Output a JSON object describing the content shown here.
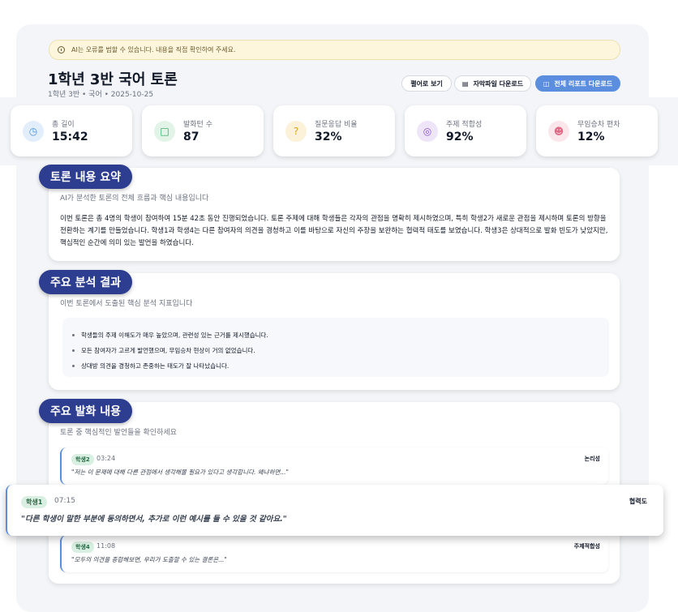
{
  "notice": {
    "text": "AI는 오류를 범할 수 있습니다. 내용을 직접 확인하여 주세요."
  },
  "header": {
    "title": "1학년 3반 국어 토론",
    "subtitle": "1학년 3반 • 국어 • 2025-10-25",
    "buttons": {
      "view": "펼어로 보기",
      "subtitle_download": "자막파일 다운로드",
      "report_download": "전체 리포트 다운로드"
    }
  },
  "stats": [
    {
      "label": "총 길이",
      "value": "15:42",
      "icon": "clock-icon",
      "color": "#4b8fe0"
    },
    {
      "label": "발화턴 수",
      "value": "87",
      "icon": "chat-icon",
      "color": "#2f9e5a"
    },
    {
      "label": "질문응답 비율",
      "value": "32%",
      "icon": "question-icon",
      "color": "#d9a21f"
    },
    {
      "label": "주제 적합성",
      "value": "92%",
      "icon": "target-icon",
      "color": "#8a54c7"
    },
    {
      "label": "무임승차 편차",
      "value": "12%",
      "icon": "users-icon",
      "color": "#e06b86"
    }
  ],
  "summary": {
    "heading": "토론 내용 요약",
    "subheading": "AI가 분석한 토론의 전체 흐름과 핵심 내용입니다",
    "body": "이번 토론은 총 4명의 학생이 참여하여 15분 42초 동안 진행되었습니다. 토론 주제에 대해 학생들은 각자의 관점을 명확히 제시하였으며, 특히 학생2가 새로운 관점을 제시하며 토론의 방향을 전환하는 계기를 만들었습니다. 학생1과 학생4는 다른 참여자의 의견을 경청하고 이를 바탕으로 자신의 주장을 보완하는 협력적 태도를 보였습니다. 학생3은 상대적으로 발화 빈도가 낮았지만, 핵심적인 순간에 의미 있는 발언을 하였습니다."
  },
  "analysis": {
    "heading": "주요 분석 결과",
    "subheading": "이번 토론에서 도출된 핵심 분석 지표입니다",
    "items": [
      "학생들의 주제 이해도가 매우 높았으며, 관련성 있는 근거를 제시했습니다.",
      "모든 참여자가 고르게 발언했으며, 무임승차 현상이 거의 없었습니다.",
      "상대방 의견을 경청하고 존중하는 태도가 잘 나타났습니다."
    ]
  },
  "utterances": {
    "heading": "주요 발화 내용",
    "subheading": "토론 중 핵심적인 발언들을 확인하세요",
    "items": [
      {
        "speaker": "학생2",
        "time": "03:24",
        "tag": "논리성",
        "text": "\"저는 이 문제에 대해 다른 관점에서 생각해볼 필요가 있다고 생각합니다. 왜냐하면...\""
      },
      {
        "speaker": "학생1",
        "time": "07:15",
        "tag": "협력도",
        "text": "\"다른 학생이 말한 부분에 동의하면서, 추가로 이런 예시를 들 수 있을 것 같아요.\""
      },
      {
        "speaker": "학생4",
        "time": "11:08",
        "tag": "주제적합성",
        "text": "\"모두의 의견을 종합해보면, 우리가 도출할 수 있는 결론은...\""
      }
    ]
  }
}
